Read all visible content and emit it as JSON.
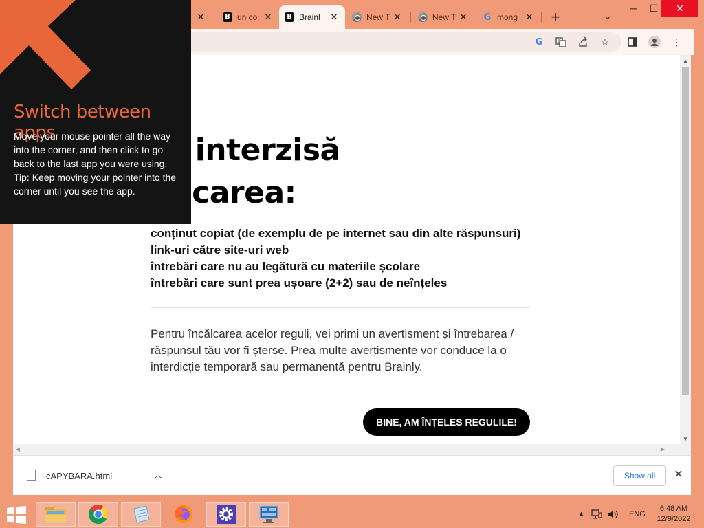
{
  "browser": {
    "tabs": [
      {
        "title": "",
        "favicon": "none",
        "active": false
      },
      {
        "title": "un co",
        "favicon": "brainly-b",
        "active": false
      },
      {
        "title": "Brainl",
        "favicon": "brainly-b",
        "active": true
      },
      {
        "title": "New T",
        "favicon": "chrome",
        "active": false
      },
      {
        "title": "New T",
        "favicon": "chrome",
        "active": false
      },
      {
        "title": "mong",
        "favicon": "google-g",
        "active": false
      }
    ],
    "new_tab_icon": "plus-icon",
    "tab_search_icon": "chevron-down-icon",
    "window_controls": [
      "minimize-icon",
      "maximize-icon",
      "close-icon"
    ],
    "toolbar_icons": [
      "google-lens-icon",
      "translate-icon",
      "share-icon",
      "star-icon",
      "side-panel-icon",
      "profile-icon",
      "menu-icon"
    ]
  },
  "page": {
    "title_line1": "te interzisă",
    "title_line2": "blicarea:",
    "rules": [
      "conținut copiat (de exemplu de pe internet sau din alte răspunsuri)",
      "link-uri către site-uri web",
      "întrebări care nu au legătură cu materiile școlare",
      "întrebări care sunt prea ușoare (2+2) sau de neînțeles"
    ],
    "note": "Pentru încălcarea acelor reguli, vei primi un avertisment și întrebarea / răspunsul tău vor fi șterse. Prea multe avertismente vor conduce la o interdicție temporară sau permanentă pentru Brainly.",
    "accept_button": "BINE, AM ÎNȚELES REGULILE!"
  },
  "downloads": {
    "file_name": "cAPYBARA.html",
    "show_all": "Show all"
  },
  "charm_tip": {
    "title": "Switch between apps",
    "body": "Move your mouse pointer all the way into the corner, and then click to go back to the last app you were using.",
    "tip": "Tip: Keep moving your pointer into the corner until you see the app."
  },
  "taskbar": {
    "apps": [
      "file-explorer-icon",
      "chrome-icon",
      "notepad-icon",
      "firefox-icon",
      "settings-gear-icon",
      "remote-desktop-icon"
    ],
    "language": "ENG",
    "time": "6:48 AM",
    "date": "12/9/2022"
  },
  "colors": {
    "frame": "#f09a78",
    "accent_orange": "#e8663a",
    "tip_bg": "#141414",
    "button_bg": "#000000",
    "close_red": "#e81123"
  }
}
